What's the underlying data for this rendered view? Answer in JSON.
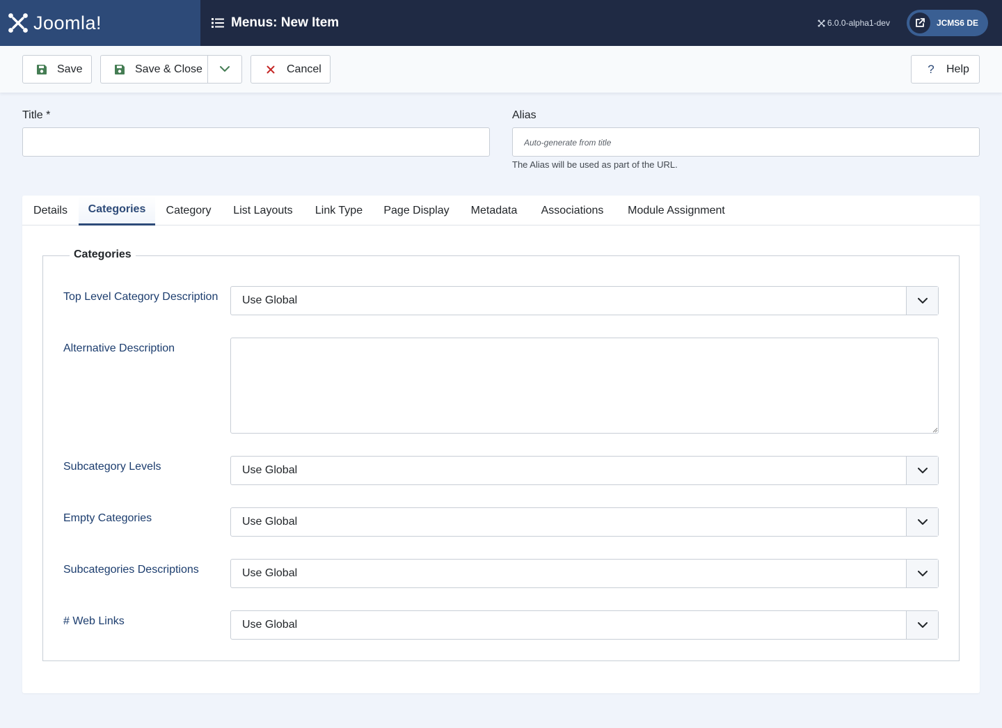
{
  "header": {
    "brand": "Joomla!",
    "title": "Menus: New Item",
    "version": "6.0.0-alpha1-dev",
    "site_name": "JCMS6 DE"
  },
  "toolbar": {
    "save_label": "Save",
    "save_close_label": "Save & Close",
    "cancel_label": "Cancel",
    "help_label": "Help"
  },
  "form": {
    "title_label": "Title *",
    "title_value": "",
    "alias_label": "Alias",
    "alias_placeholder": "Auto-generate from title",
    "alias_hint": "The Alias will be used as part of the URL."
  },
  "tabs": [
    {
      "label": "Details"
    },
    {
      "label": "Categories",
      "active": true
    },
    {
      "label": "Category"
    },
    {
      "label": "List Layouts"
    },
    {
      "label": "Link Type"
    },
    {
      "label": "Page Display"
    },
    {
      "label": "Metadata"
    },
    {
      "label": "Associations"
    },
    {
      "label": "Module Assignment"
    }
  ],
  "categories": {
    "legend": "Categories",
    "top_level_description": {
      "label": "Top Level Category Description",
      "value": "Use Global"
    },
    "alternative_description": {
      "label": "Alternative Description",
      "value": ""
    },
    "subcategory_levels": {
      "label": "Subcategory Levels",
      "value": "Use Global"
    },
    "empty_categories": {
      "label": "Empty Categories",
      "value": "Use Global"
    },
    "subcategories_descriptions": {
      "label": "Subcategories Descriptions",
      "value": "Use Global"
    },
    "web_links": {
      "label": "# Web Links",
      "value": "Use Global"
    }
  },
  "colors": {
    "header_bg": "#1f2a44",
    "brand_bg": "#2d4a78",
    "save_icon": "#457d54",
    "cancel_icon": "#c52827",
    "help_icon": "#2d4a78",
    "label_text": "#1c3d6e"
  }
}
